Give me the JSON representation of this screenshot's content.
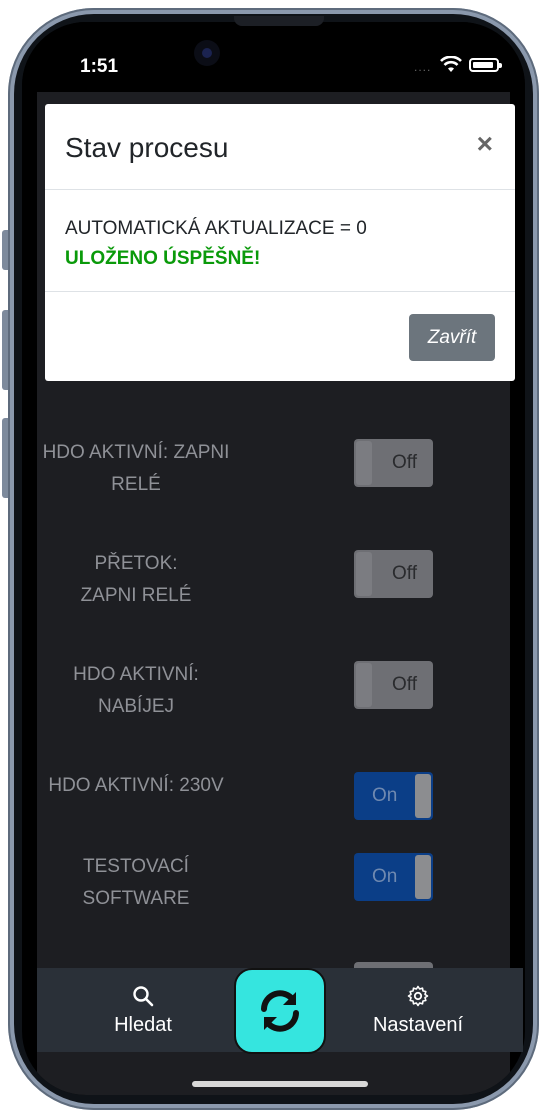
{
  "status_bar": {
    "time": "1:51",
    "signal": "...."
  },
  "dialog": {
    "title": "Stav procesu",
    "close_symbol": "×",
    "message": "AUTOMATICKÁ AKTUALIZACE = 0",
    "success_message": "ULOŽENO ÚSPĚŠNĚ!",
    "close_button": "Zavřít"
  },
  "settings": [
    {
      "label": "HDO AKTIVNÍ: ZAPNI RELÉ",
      "state": "Off"
    },
    {
      "label": "PŘETOK: ZAPNI RELÉ",
      "state": "Off"
    },
    {
      "label": "HDO AKTIVNÍ: NABÍJEJ",
      "state": "Off"
    },
    {
      "label": "HDO AKTIVNÍ: 230V",
      "state": "On"
    },
    {
      "label": "TESTOVACÍ SOFTWARE",
      "state": "On"
    }
  ],
  "tabbar": {
    "search_label": "Hledat",
    "settings_label": "Nastavení",
    "search_icon": "search-icon",
    "settings_icon": "gear-icon",
    "refresh_icon": "refresh-icon"
  },
  "colors": {
    "accent_fab": "#35e5df",
    "success": "#0a9a0a",
    "toggle_on": "#0b3e87",
    "toggle_off": "#6e6f74"
  }
}
